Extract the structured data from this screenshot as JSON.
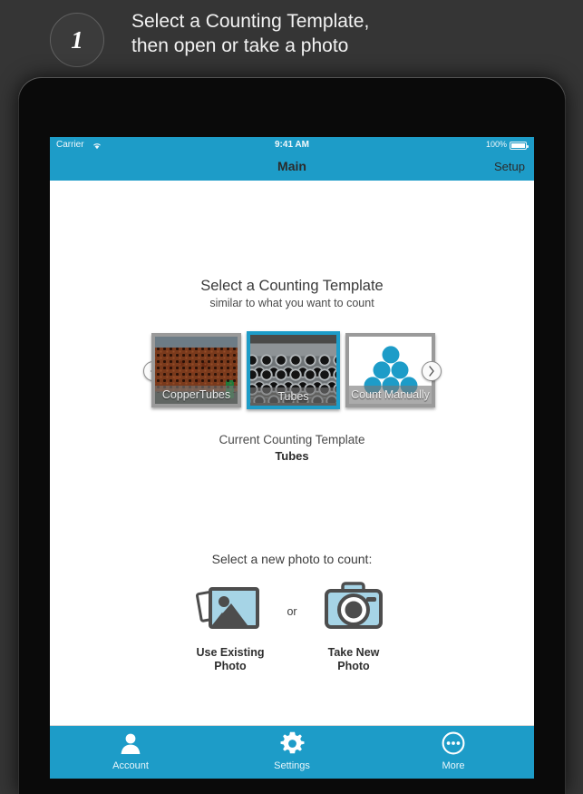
{
  "promo": {
    "step_number": "1",
    "line1": "Select a Counting Template,",
    "line2": "then open or take a photo"
  },
  "status_bar": {
    "carrier": "Carrier",
    "wifi_icon": "wifi-icon",
    "time": "9:41 AM",
    "battery_percent": "100%",
    "battery_icon": "battery-full-icon"
  },
  "nav_bar": {
    "title": "Main",
    "right_button": "Setup"
  },
  "template_section": {
    "title": "Select a Counting Template",
    "subtitle": "similar to what you want to count",
    "prev_arrow_icon": "chevron-left-icon",
    "next_arrow_icon": "chevron-right-icon",
    "templates": [
      {
        "label": "CopperTubes",
        "selected": false
      },
      {
        "label": "Tubes",
        "selected": true
      },
      {
        "label": "Count Manually",
        "selected": false
      }
    ],
    "current_label": "Current Counting Template",
    "current_value": "Tubes"
  },
  "photo_section": {
    "prompt": "Select a new photo to count:",
    "existing": {
      "icon": "photo-library-icon",
      "line1": "Use Existing",
      "line2": "Photo"
    },
    "separator": "or",
    "new": {
      "icon": "camera-icon",
      "line1": "Take New",
      "line2": "Photo"
    }
  },
  "tab_bar": {
    "tabs": [
      {
        "label": "Account",
        "icon": "person-icon"
      },
      {
        "label": "Settings",
        "icon": "gear-icon"
      },
      {
        "label": "More",
        "icon": "ellipsis-circle-icon"
      }
    ]
  },
  "colors": {
    "accent_blue": "#1d9cc8",
    "page_background": "#353535",
    "icon_light_blue": "#a6d4e6",
    "icon_dark_gray": "#4d4d4d"
  }
}
